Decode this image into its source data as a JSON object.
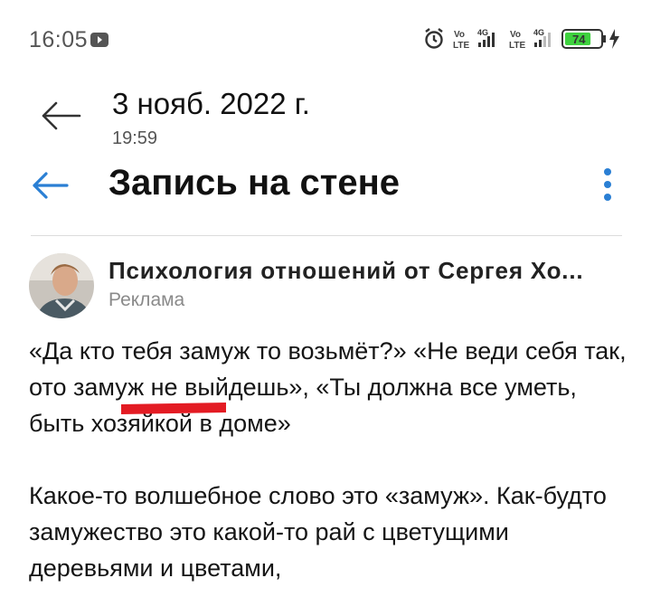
{
  "status_bar": {
    "time": "16:05",
    "battery_level": "74",
    "colors": {
      "battery": "#3ed13e"
    }
  },
  "header": {
    "date": "3 нояб. 2022 г.",
    "time": "19:59"
  },
  "app_bar": {
    "title": "Запись на стене",
    "accent_color": "#2a7fd4"
  },
  "post": {
    "author": "Психология отношений от Сергея Хо...",
    "label": "Реклама",
    "paragraphs": [
      "«Да кто тебя замуж то возьмёт?» «Не веди себя так, ото замуж не выйдешь», «Ты должна все уметь, быть хозяйкой в доме»",
      "Какое-то волшебное слово это «замуж». Как-будто замужество это какой-то рай с цветущими деревьями и цветами,"
    ],
    "highlight_color": "#e31b23"
  }
}
